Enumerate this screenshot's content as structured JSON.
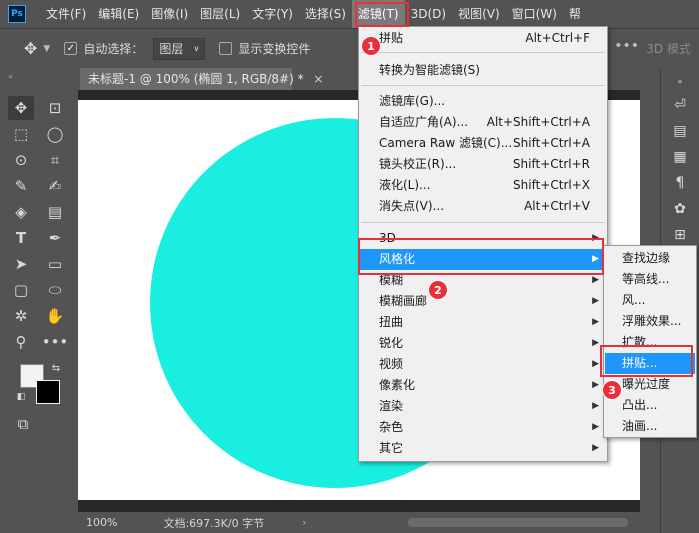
{
  "app": {
    "logo": "Ps"
  },
  "menubar": {
    "items": [
      {
        "label": "文件(F)"
      },
      {
        "label": "编辑(E)"
      },
      {
        "label": "图像(I)"
      },
      {
        "label": "图层(L)"
      },
      {
        "label": "文字(Y)"
      },
      {
        "label": "选择(S)"
      },
      {
        "label": "滤镜(T)"
      },
      {
        "label": "3D(D)"
      },
      {
        "label": "视图(V)"
      },
      {
        "label": "窗口(W)"
      },
      {
        "label": "帮"
      }
    ],
    "active_index": 6
  },
  "options": {
    "auto_select_label": "自动选择：",
    "auto_select_checked": true,
    "layer_select_value": "图层",
    "show_transform_label": "显示变换控件",
    "mode_3d_label": "3D 模式"
  },
  "document": {
    "tab_title": "未标题-1 @ 100% (椭圆 1, RGB/8#) *",
    "circle_color": "#1aeee0",
    "canvas_color": "#ffffff"
  },
  "status": {
    "zoom": "100%",
    "doc_info": "文档:697.3K/0 字节"
  },
  "filter_menu": {
    "items": [
      {
        "label": "拼贴",
        "shortcut": "Alt+Ctrl+F"
      },
      {
        "label": "转换为智能滤镜(S)"
      },
      {
        "label": "滤镜库(G)..."
      },
      {
        "label": "自适应广角(A)...",
        "shortcut": "Alt+Shift+Ctrl+A"
      },
      {
        "label": "Camera Raw 滤镜(C)...",
        "shortcut": "Shift+Ctrl+A"
      },
      {
        "label": "镜头校正(R)...",
        "shortcut": "Shift+Ctrl+R"
      },
      {
        "label": "液化(L)...",
        "shortcut": "Shift+Ctrl+X"
      },
      {
        "label": "消失点(V)...",
        "shortcut": "Alt+Ctrl+V"
      },
      {
        "label": "3D"
      },
      {
        "label": "风格化"
      },
      {
        "label": "模糊"
      },
      {
        "label": "模糊画廊"
      },
      {
        "label": "扭曲"
      },
      {
        "label": "锐化"
      },
      {
        "label": "视频"
      },
      {
        "label": "像素化"
      },
      {
        "label": "渲染"
      },
      {
        "label": "杂色"
      },
      {
        "label": "其它"
      }
    ]
  },
  "stylize_submenu": {
    "items": [
      {
        "label": "查找边缘"
      },
      {
        "label": "等高线..."
      },
      {
        "label": "风..."
      },
      {
        "label": "浮雕效果..."
      },
      {
        "label": "扩散..."
      },
      {
        "label": "拼贴..."
      },
      {
        "label": "曝光过度"
      },
      {
        "label": "凸出..."
      },
      {
        "label": "油画..."
      }
    ]
  },
  "annotations": {
    "badges": [
      "1",
      "2",
      "3"
    ],
    "color": "#e8303a"
  },
  "accent": "#1e96fa"
}
